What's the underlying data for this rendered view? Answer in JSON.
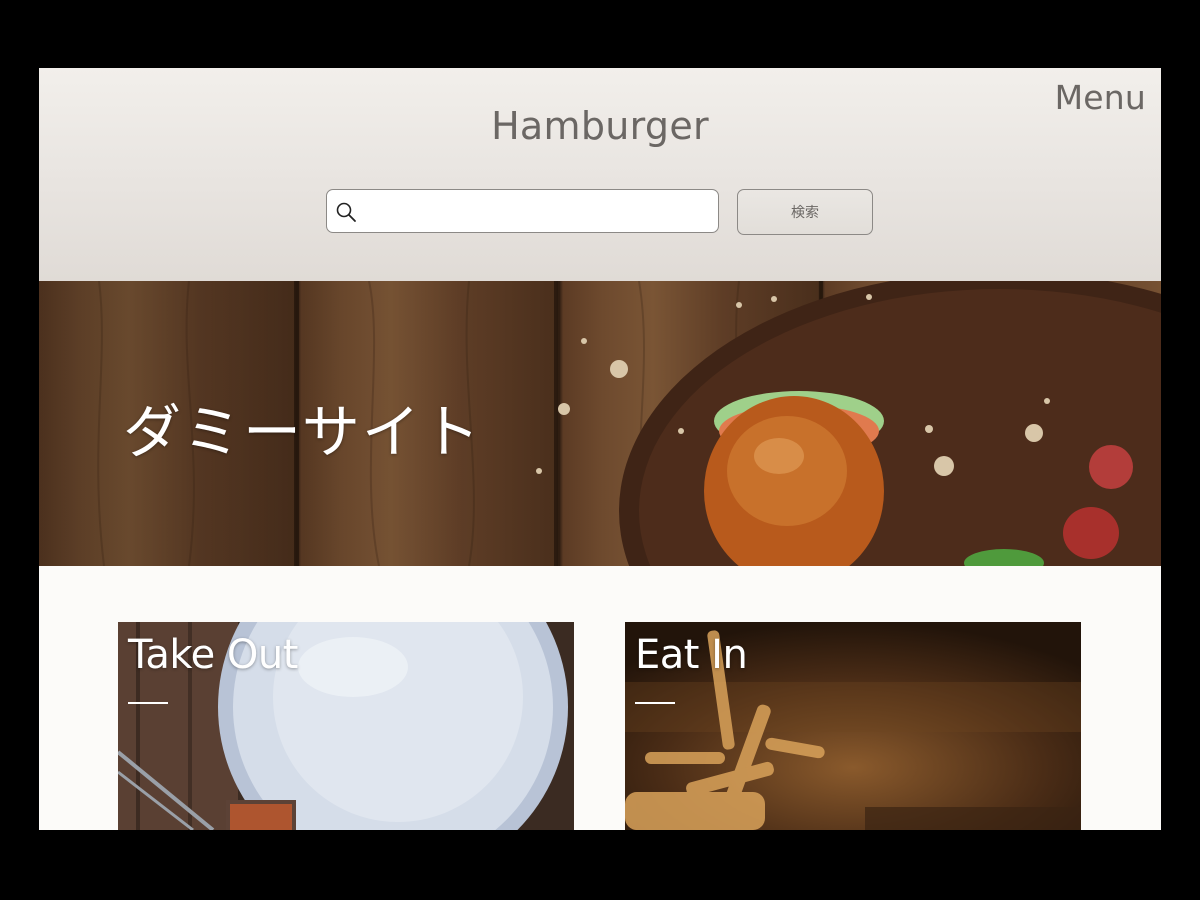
{
  "header": {
    "title": "Hamburger",
    "menu_label": "Menu",
    "search": {
      "value": "",
      "placeholder": "",
      "button_label": "検索"
    }
  },
  "hero": {
    "title": "ダミーサイト"
  },
  "cards": [
    {
      "title": "Take Out"
    },
    {
      "title": "Eat In"
    }
  ],
  "icons": {
    "search": "search-icon",
    "menu": "menu-text"
  },
  "colors": {
    "header_text": "#6b6764",
    "header_bg": "#ebe7e3",
    "page_bg": "#fcfbf9",
    "hero_text": "#ffffff"
  }
}
